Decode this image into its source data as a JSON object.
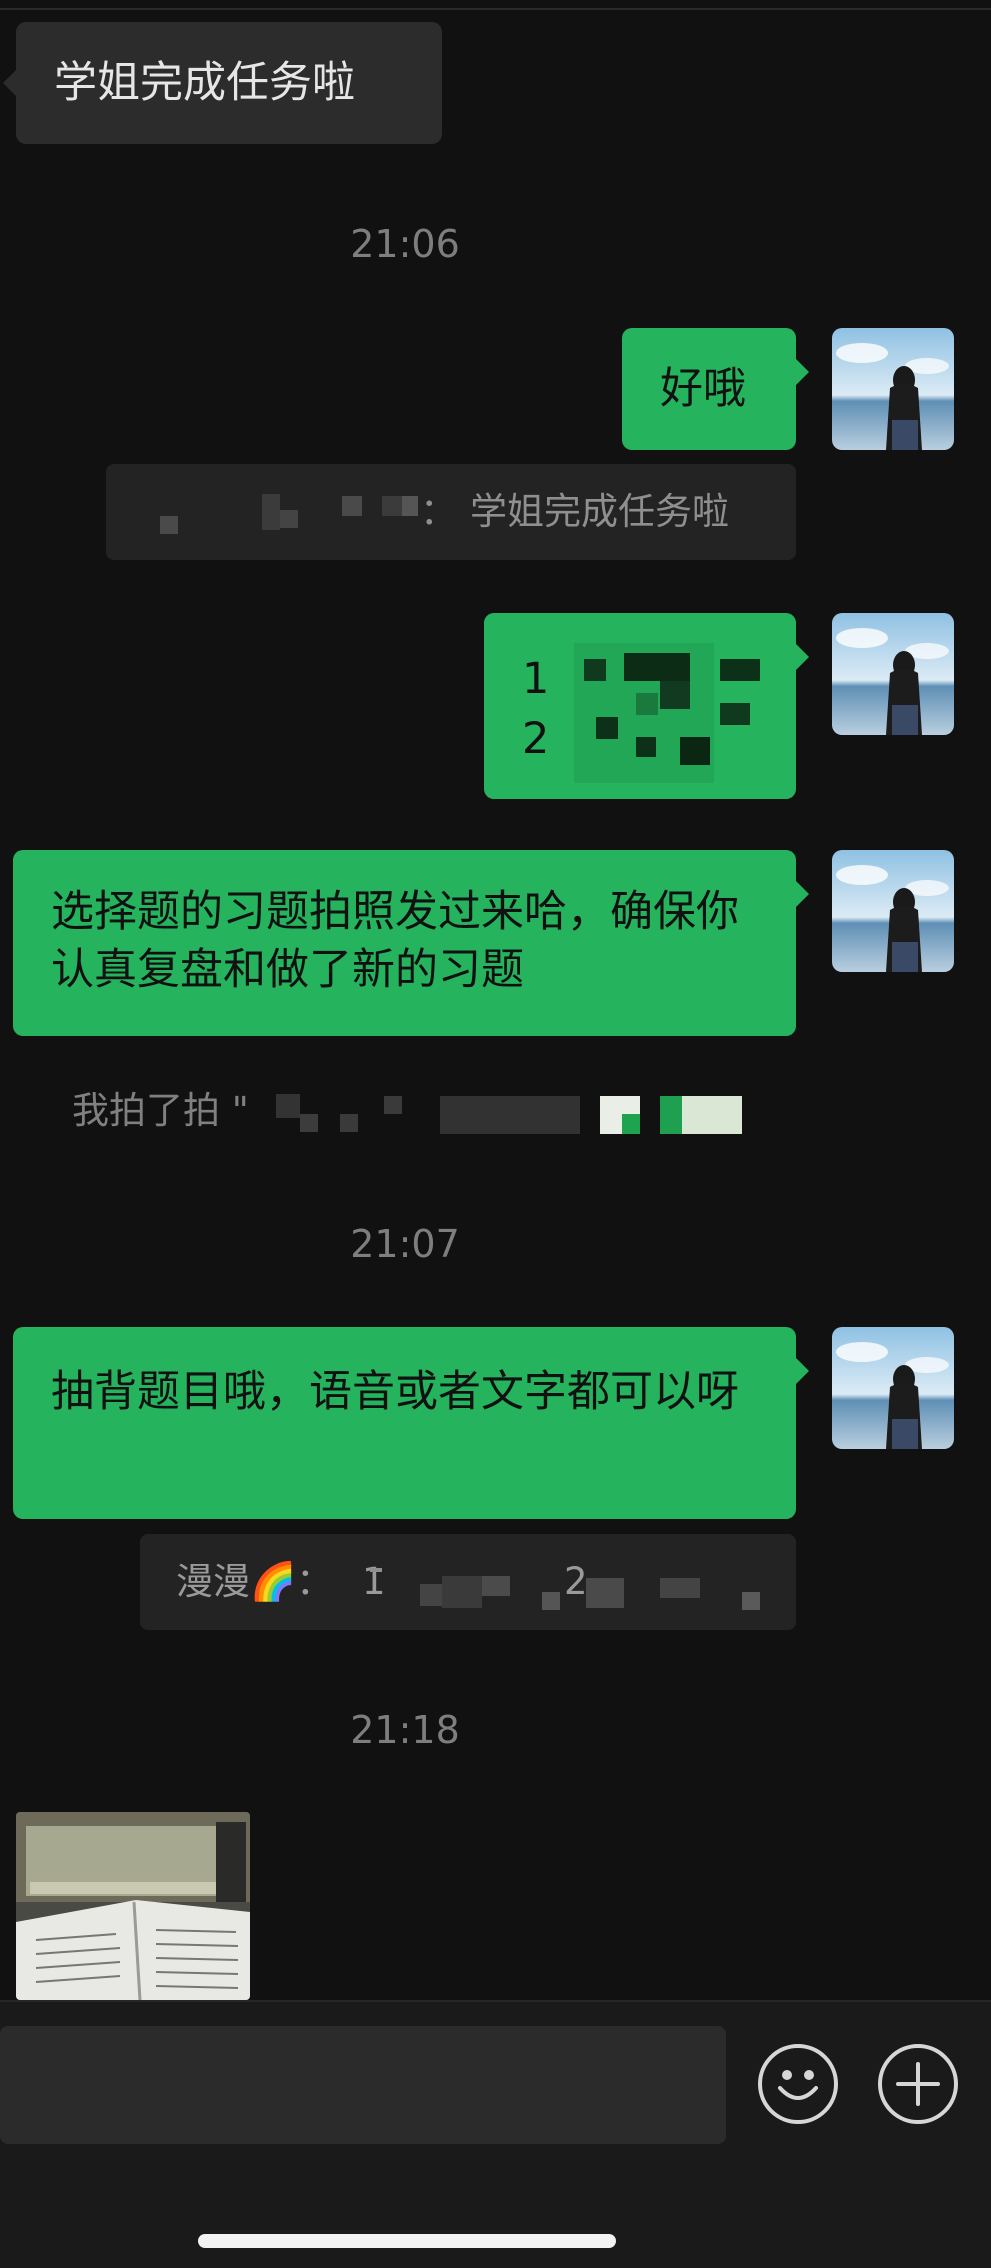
{
  "messages": {
    "m1": "学姐完成任务啦",
    "t1": "21:06",
    "m2": "好哦",
    "q1_prefix": "：",
    "q1_text": "学姐完成任务啦",
    "m3_line1": "1",
    "m3_line2": "2",
    "m4": "选择题的习题拍照发过来哈，确保你认真复盘和做了新的习题",
    "tickle": "我拍了拍 \"",
    "t2": "21:07",
    "m5": "抽背题目哦，语音或者文字都可以呀",
    "q2_name": "漫漫🌈：",
    "q2_text": "1",
    "q2_text2": "2",
    "t3": "21:18"
  },
  "input": {
    "emoji_icon": "smiley-face",
    "add_icon": "plus-circle"
  },
  "colors": {
    "background": "#111111",
    "outgoing_bubble": "#25b35e",
    "incoming_bubble": "#2c2c2c",
    "timestamp": "#7e7e7e"
  }
}
